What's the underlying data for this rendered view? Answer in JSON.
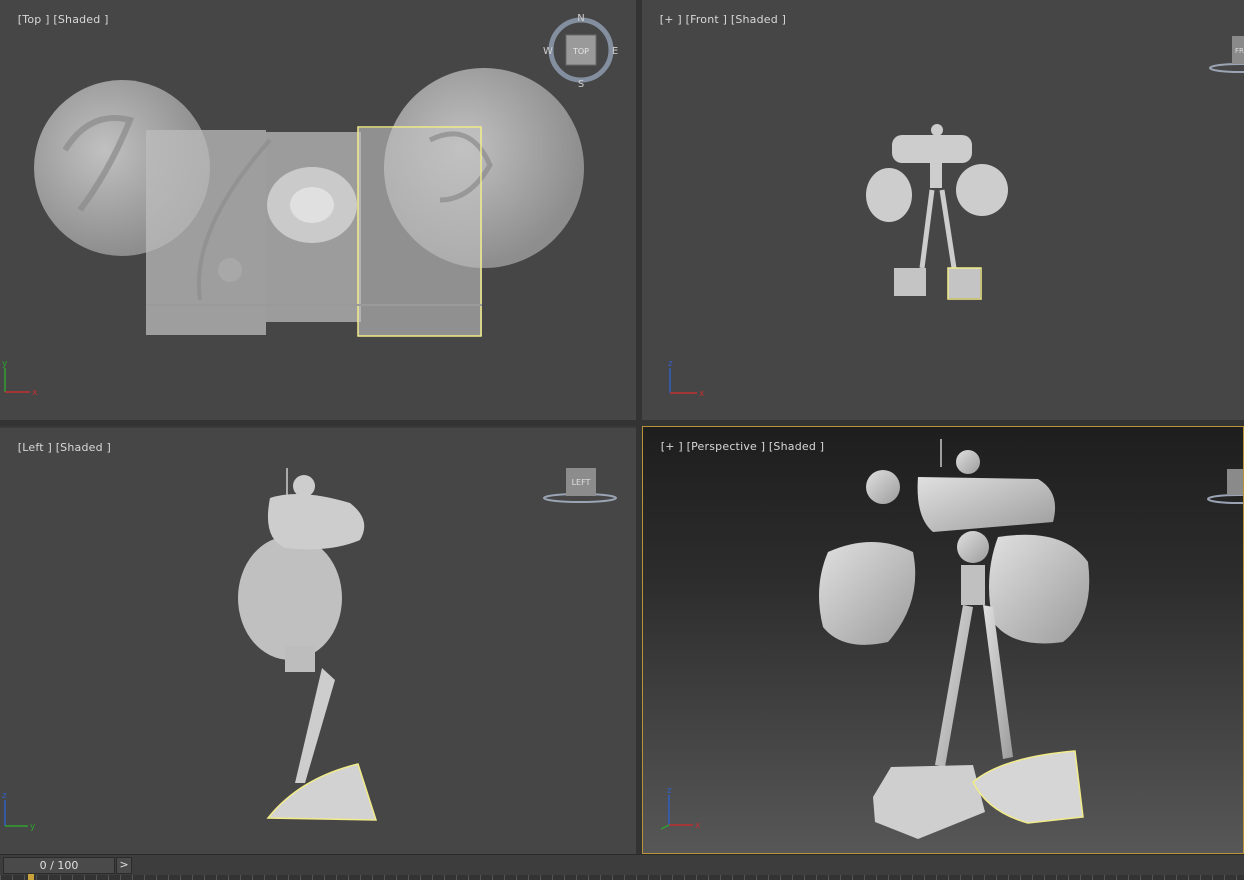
{
  "viewports": {
    "top": {
      "label_parts": [
        "[Top ]",
        "[Shaded ]"
      ]
    },
    "front": {
      "label_parts": [
        "[+ ]",
        "[Front ]",
        "[Shaded ]"
      ]
    },
    "left": {
      "label_parts": [
        "[Left ]",
        "[Shaded ]"
      ]
    },
    "perspective": {
      "label_parts": [
        "[+ ]",
        "[Perspective ]",
        "[Shaded ]"
      ]
    }
  },
  "viewcube": {
    "top_face": "TOP",
    "left_face": "LEFT",
    "front_face_partial": "FR",
    "compass": {
      "north": "N",
      "south": "S",
      "east": "E",
      "west": "W"
    }
  },
  "axes": {
    "top": {
      "vertical": "y",
      "horizontal": "x"
    },
    "front": {
      "vertical": "z",
      "horizontal": "x"
    },
    "left": {
      "vertical": "z",
      "horizontal": "y"
    },
    "perspective": {
      "vertical": "z",
      "horizontal": "x"
    }
  },
  "timeline": {
    "frame_display": "0 / 100",
    "next_label": ">"
  },
  "colors": {
    "viewport_bg": "#464646",
    "active_border": "#b8933a",
    "selection": "#f1eb8a",
    "model": "#cfcfcf",
    "axis_x": "#c03030",
    "axis_y": "#30a030",
    "axis_z": "#3060c0"
  }
}
